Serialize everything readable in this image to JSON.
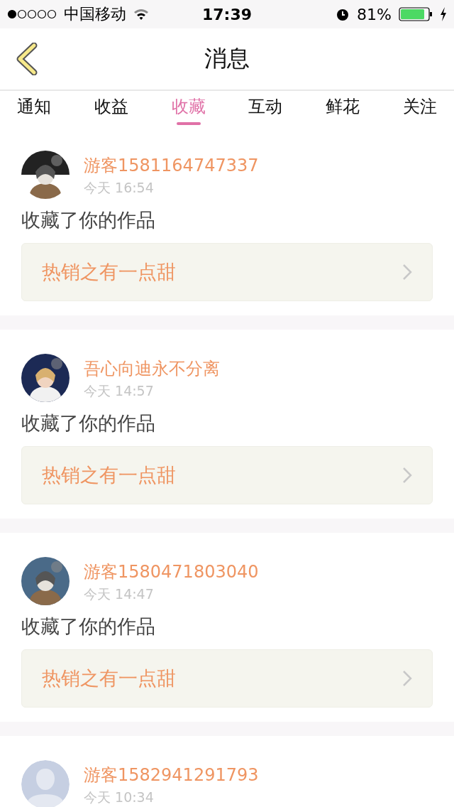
{
  "status_bar": {
    "carrier": "中国移动",
    "time": "17:39",
    "battery": "81%"
  },
  "nav": {
    "title": "消息"
  },
  "tabs": [
    {
      "label": "通知",
      "selected": false
    },
    {
      "label": "收益",
      "selected": false
    },
    {
      "label": "收藏",
      "selected": true
    },
    {
      "label": "互动",
      "selected": false
    },
    {
      "label": "鲜花",
      "selected": false
    },
    {
      "label": "关注",
      "selected": false
    }
  ],
  "messages": [
    {
      "user": "游客1581164747337",
      "time": "今天 16:54",
      "text": "收藏了你的作品",
      "work": "热销之有一点甜"
    },
    {
      "user": "吾心向迪永不分离",
      "time": "今天 14:57",
      "text": "收藏了你的作品",
      "work": "热销之有一点甜"
    },
    {
      "user": "游客1580471803040",
      "time": "今天 14:47",
      "text": "收藏了你的作品",
      "work": "热销之有一点甜"
    },
    {
      "avatar": {
        "kind": "placeholder"
      },
      "user": "游客1582941291793",
      "time": "今天 10:34"
    }
  ]
}
